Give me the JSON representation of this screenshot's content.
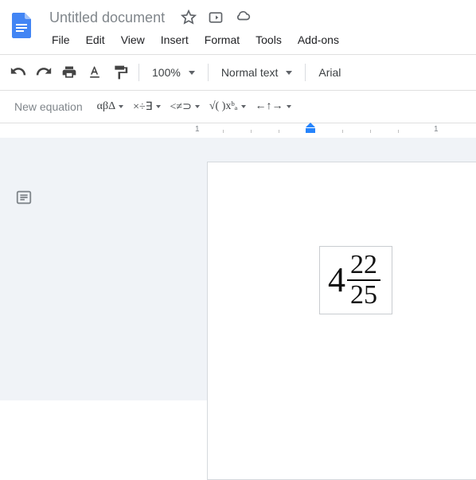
{
  "header": {
    "title": "Untitled document"
  },
  "menubar": {
    "file": "File",
    "edit": "Edit",
    "view": "View",
    "insert": "Insert",
    "format": "Format",
    "tools": "Tools",
    "addons": "Add-ons"
  },
  "toolbar": {
    "zoom": "100%",
    "style": "Normal text",
    "font": "Arial"
  },
  "equation_toolbar": {
    "new_equation": "New equation",
    "greek": "αβΔ",
    "ops": "×÷∃",
    "rel": "<≠⊃",
    "misc": "√( )xᵇₐ",
    "arrows": "←↑→"
  },
  "ruler": {
    "mark_a": "1",
    "mark_b": "1"
  },
  "equation": {
    "whole": "4",
    "numerator": "22",
    "denominator": "25"
  }
}
